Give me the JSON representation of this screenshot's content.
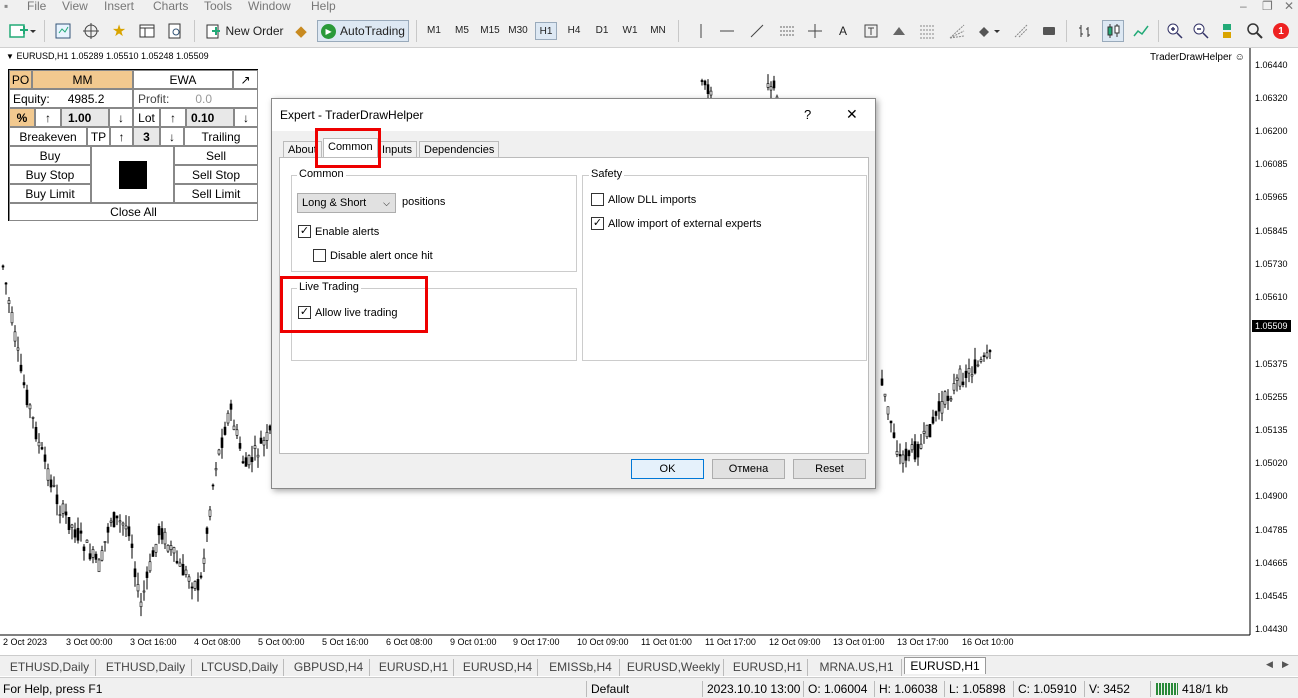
{
  "menubar": {
    "items": [
      "File",
      "View",
      "Insert",
      "Charts",
      "Tools",
      "Window",
      "Help"
    ]
  },
  "toolbar": {
    "new_order": "New Order",
    "autotrading": "AutoTrading",
    "timeframes": [
      "M1",
      "M5",
      "M15",
      "M30",
      "H1",
      "H4",
      "D1",
      "W1",
      "MN"
    ],
    "active_timeframe": "H1",
    "text_tool": "A",
    "notification_count": "1"
  },
  "chart": {
    "header": "EURUSD,H1  1.05289 1.05510 1.05248 1.05509",
    "ea_label": "TraderDrawHelper",
    "prices": [
      "1.06440",
      "1.06320",
      "1.06200",
      "1.06085",
      "1.05965",
      "1.05845",
      "1.05730",
      "1.05610",
      "1.05375",
      "1.05255",
      "1.05135",
      "1.05020",
      "1.04900",
      "1.04785",
      "1.04665",
      "1.04545",
      "1.04430"
    ],
    "current_price": "1.05509",
    "dates": [
      "2 Oct 2023",
      "3 Oct 00:00",
      "3 Oct 16:00",
      "4 Oct 08:00",
      "5 Oct 00:00",
      "5 Oct 16:00",
      "6 Oct 08:00",
      "9 Oct 01:00",
      "9 Oct 17:00",
      "10 Oct 09:00",
      "11 Oct 01:00",
      "11 Oct 17:00",
      "12 Oct 09:00",
      "13 Oct 01:00",
      "13 Oct 17:00",
      "16 Oct 10:00"
    ]
  },
  "panel": {
    "po": "PO",
    "mm": "MM",
    "ewa": "EWA",
    "expand": "↗",
    "equity_label": "Equity:",
    "equity_value": "4985.2",
    "profit_label": "Profit:",
    "profit_value": "0.0",
    "pct": "%",
    "up": "↑",
    "down": "↓",
    "mm_value": "1.00",
    "lot_label": "Lot",
    "lot_value": "0.10",
    "breakeven": "Breakeven",
    "tp": "TP",
    "tp_value": "3",
    "trailing": "Trailing",
    "buy": "Buy",
    "sell": "Sell",
    "buy_stop": "Buy Stop",
    "sell_stop": "Sell Stop",
    "buy_limit": "Buy Limit",
    "sell_limit": "Sell Limit",
    "close_all": "Close All"
  },
  "dialog": {
    "title": "Expert - TraderDrawHelper",
    "help": "?",
    "close": "✕",
    "tabs": [
      "About",
      "Common",
      "Inputs",
      "Dependencies"
    ],
    "selected_tab": "Common",
    "common_group": "Common",
    "positions_select": "Long & Short",
    "positions_label": "positions",
    "enable_alerts": "Enable alerts",
    "enable_alerts_checked": true,
    "disable_alert": "Disable alert once hit",
    "disable_alert_checked": false,
    "live_group": "Live Trading",
    "allow_live": "Allow live trading",
    "allow_live_checked": true,
    "safety_group": "Safety",
    "allow_dll": "Allow DLL imports",
    "allow_dll_checked": false,
    "allow_import": "Allow import of external experts",
    "allow_import_checked": true,
    "ok": "OK",
    "cancel": "Отмена",
    "reset": "Reset"
  },
  "chart_tabs": [
    "ETHUSD,Daily",
    "ETHUSD,Daily",
    "LTCUSD,Daily",
    "GBPUSD,H4",
    "EURUSD,H1",
    "EURUSD,H4",
    "EMISSb,H4",
    "EURUSD,Weekly",
    "EURUSD,H1",
    "MRNA.US,H1",
    "EURUSD,H1"
  ],
  "active_chart_tab": 10,
  "statusbar": {
    "help": "For Help, press F1",
    "profile": "Default",
    "datetime": "2023.10.10 13:00",
    "open": "O: 1.06004",
    "high": "H: 1.06038",
    "low": "L: 1.05898",
    "close": "C: 1.05910",
    "volume": "V: 3452",
    "traffic": "418/1 kb"
  }
}
